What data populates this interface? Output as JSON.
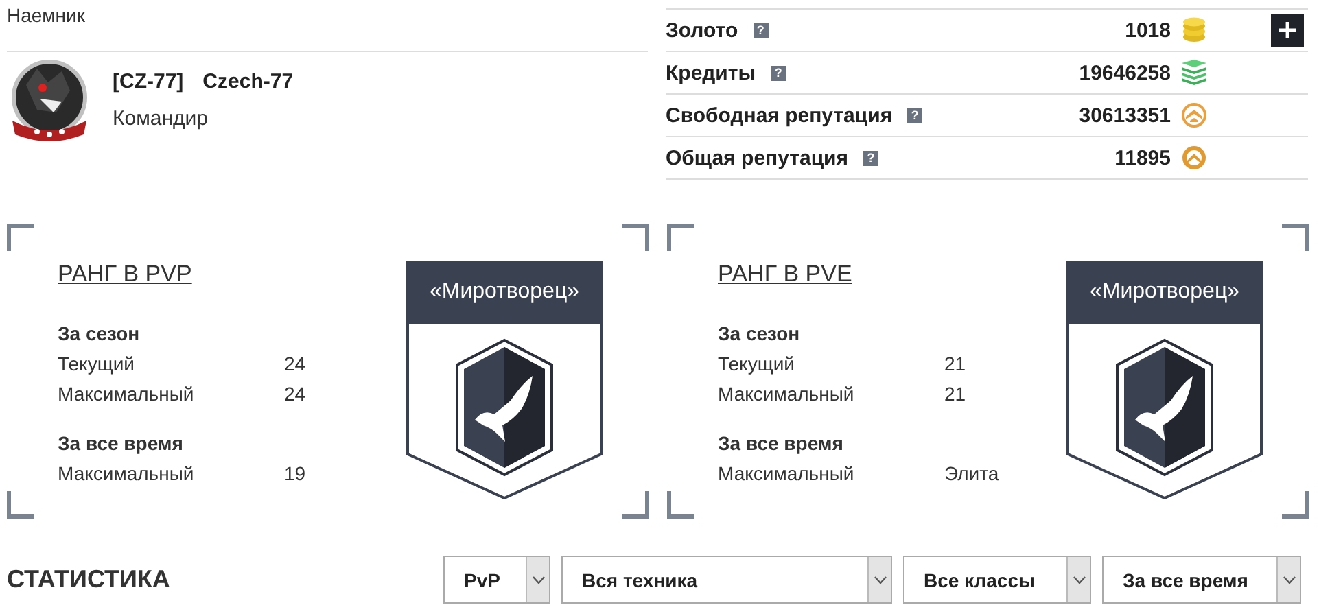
{
  "header": {
    "title": "Наемник"
  },
  "player": {
    "clan_tag": "[CZ-77]",
    "name": "Czech-77",
    "role": "Командир"
  },
  "currencies": [
    {
      "label": "Золото",
      "help": "?",
      "value": "1018",
      "kind": "gold",
      "add_button": true
    },
    {
      "label": "Кредиты",
      "help": "?",
      "value": "19646258",
      "kind": "credits",
      "add_button": false
    },
    {
      "label": "Свободная репутация",
      "help": "?",
      "value": "30613351",
      "kind": "free_xp",
      "add_button": false
    },
    {
      "label": "Общая репутация",
      "help": "?",
      "value": "11895",
      "kind": "xp",
      "add_button": false
    }
  ],
  "ranks": [
    {
      "title": "РАНГ В PVP",
      "badge": "«Миротворец»",
      "sections": [
        {
          "heading": "За сезон",
          "rows": [
            {
              "label": "Текущий",
              "value": "24"
            },
            {
              "label": "Максимальный",
              "value": "24"
            }
          ]
        },
        {
          "heading": "За все время",
          "rows": [
            {
              "label": "Максимальный",
              "value": "19"
            }
          ]
        }
      ]
    },
    {
      "title": "РАНГ В PVE",
      "badge": "«Миротворец»",
      "sections": [
        {
          "heading": "За сезон",
          "rows": [
            {
              "label": "Текущий",
              "value": "21"
            },
            {
              "label": "Максимальный",
              "value": "21"
            }
          ]
        },
        {
          "heading": "За все время",
          "rows": [
            {
              "label": "Максимальный",
              "value": "Элита"
            }
          ]
        }
      ]
    }
  ],
  "statistics": {
    "title": "СТАТИСТИКА",
    "filters": [
      {
        "value": "PvP",
        "kind": "mode"
      },
      {
        "value": "Вся техника",
        "kind": "vehicles"
      },
      {
        "value": "Все классы",
        "kind": "classes"
      },
      {
        "value": "За все время",
        "kind": "period"
      }
    ]
  }
}
